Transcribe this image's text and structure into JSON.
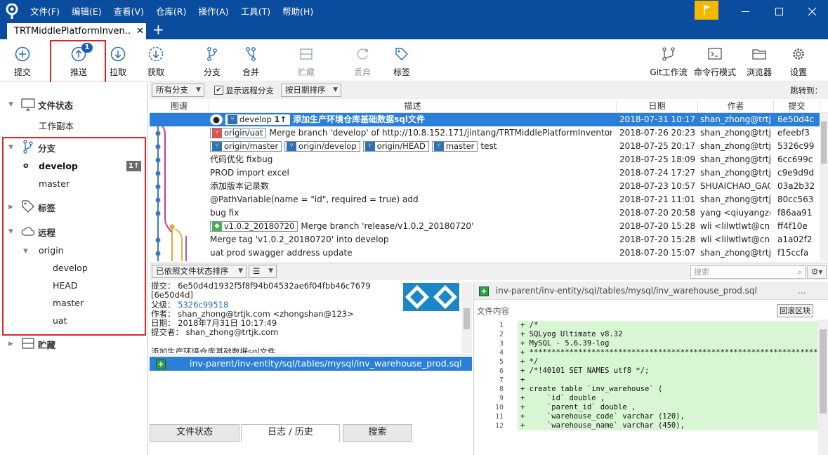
{
  "window": {
    "menus": [
      "文件(F)",
      "编辑(E)",
      "查看(V)",
      "仓库(R)",
      "操作(A)",
      "工具(T)",
      "帮助(H)"
    ],
    "tab_title": "TRTMiddlePlatformInven.."
  },
  "toolbar": {
    "commit": "提交",
    "push": "推送",
    "push_badge": "1",
    "pull": "拉取",
    "fetch": "获取",
    "branch": "分支",
    "merge": "合并",
    "stash": "贮藏",
    "discard": "丢弃",
    "tag": "标签",
    "git_flow": "Git工作流",
    "terminal": "命令行模式",
    "explorer": "浏览器",
    "settings": "设置"
  },
  "sidebar": {
    "file_status": "文件状态",
    "working_copy": "工作副本",
    "branches": "分支",
    "current_branch": "develop",
    "current_branch_badge": "1↑",
    "branch2": "master",
    "tags": "标签",
    "remotes": "远程",
    "origin": "origin",
    "remote_branches": [
      "develop",
      "HEAD",
      "master",
      "uat"
    ],
    "stashes": "贮藏"
  },
  "filter": {
    "branch_select": "所有分支",
    "show_remote": "显示远程分支",
    "sort": "按日期排序",
    "jump_to": "跳转到："
  },
  "columns": {
    "graph": "图谱",
    "description": "描述",
    "date": "日期",
    "author": "作者",
    "commit": "提交"
  },
  "commits": [
    {
      "desc": "添加生产环境仓库基础数据sql文件",
      "date": "2018-07-31 10:17",
      "author": "shan_zhong@trtj",
      "hash": "6e50d4c"
    },
    {
      "desc": "Merge branch 'develop' of http://10.8.152.171/jintang/TRTMiddlePlatformInventory",
      "date": "2018-07-26 20:23",
      "author": "shan_zhong@trtj",
      "hash": "efeebf3"
    },
    {
      "desc": "test",
      "date": "2018-07-25 20:17",
      "author": "shan_zhong@trtj",
      "hash": "5326c99"
    },
    {
      "desc": "代码优化 fixbug",
      "date": "2018-07-25 18:09",
      "author": "shan_zhong@trtj",
      "hash": "6cc699c"
    },
    {
      "desc": "PROD import excel",
      "date": "2018-07-24 17:27",
      "author": "shan_zhong@trtj",
      "hash": "c9e9d9d"
    },
    {
      "desc": "添加版本记录数",
      "date": "2018-07-23 10:57",
      "author": "SHUAICHAO_GAO",
      "hash": "03a2b32"
    },
    {
      "desc": "@PathVariable(name = \"id\", required = true) add",
      "date": "2018-07-21 11:01",
      "author": "shan_zhong@trtj",
      "hash": "80cc563"
    },
    {
      "desc": "bug fix",
      "date": "2018-07-20 20:58",
      "author": "yang <qiuyangz@",
      "hash": "f86aa91"
    },
    {
      "desc": "Merge branch 'release/v1.0.2_20180720'",
      "date": "2018-07-20 15:28",
      "author": "wli <lilwtlwt@cn.",
      "hash": "ff4f10e"
    },
    {
      "desc": "Merge tag 'v1.0.2_20180720' into develop",
      "date": "2018-07-20 15:28",
      "author": "wli <lilwtlwt@cn.",
      "hash": "a1a02f2"
    },
    {
      "desc": "uat prod swagger address update",
      "date": "2018-07-20 15:07",
      "author": "shan_zhong@trtj",
      "hash": "f15ccfa"
    }
  ],
  "refs": {
    "r0": [
      "develop",
      "1↑"
    ],
    "r1": [
      "origin/uat"
    ],
    "r2": [
      "origin/master",
      "origin/develop",
      "origin/HEAD",
      "master"
    ],
    "r8": [
      "v1.0.2_20180720"
    ]
  },
  "lower": {
    "sort_select": "已依照文件状态排序",
    "search_placeholder": "搜索"
  },
  "details": {
    "commit": "提交：  6e50d4d1932f5f8f94b04532ae6f04fbb46c7679",
    "short": "[6e50d4d]",
    "parent_label": "父级：",
    "parent": "5326c99518",
    "author": "作者：  shan_zhong@trtjk.com <zhongshan@123>",
    "date": "日期：  2018年7月31日 10:17:49",
    "committer": "提交者：  shan_zhong@trtjk.com",
    "message": "添加生产环境仓库基础数据sql文件"
  },
  "file": {
    "path": "inv-parent/inv-entity/sql/tables/mysql/inv_warehouse_prod.sql"
  },
  "bottom_tabs": [
    "文件状态",
    "日志 / 历史",
    "搜索"
  ],
  "diff": {
    "path": "inv-parent/inv-entity/sql/tables/mysql/inv_warehouse_prod.sql",
    "more": "...",
    "content_label": "文件内容",
    "rollback": "回滚区块",
    "lines": [
      {
        "n": "1",
        "t": "+ /*"
      },
      {
        "n": "2",
        "t": "+ SQLyog Ultimate v8.32"
      },
      {
        "n": "3",
        "t": "+ MySQL - 5.6.39-log"
      },
      {
        "n": "4",
        "t": "+ *********************************************************************"
      },
      {
        "n": "5",
        "t": "+ */"
      },
      {
        "n": "6",
        "t": "+ /*!40101 SET NAMES utf8 */;"
      },
      {
        "n": "7",
        "t": "+"
      },
      {
        "n": "8",
        "t": "+ create table `inv_warehouse` ("
      },
      {
        "n": "9",
        "t": "+     `id` double ,"
      },
      {
        "n": "10",
        "t": "+     `parent_id` double ,"
      },
      {
        "n": "11",
        "t": "+     `warehouse_code` varchar (120),"
      },
      {
        "n": "12",
        "t": "+     `warehouse_name` varchar (450),"
      }
    ]
  },
  "colors": {
    "titlebar": "#0a4d9e",
    "selection": "#2c7fd9",
    "highlight": "#e0232b",
    "diff_added": "#d8f6d4"
  }
}
